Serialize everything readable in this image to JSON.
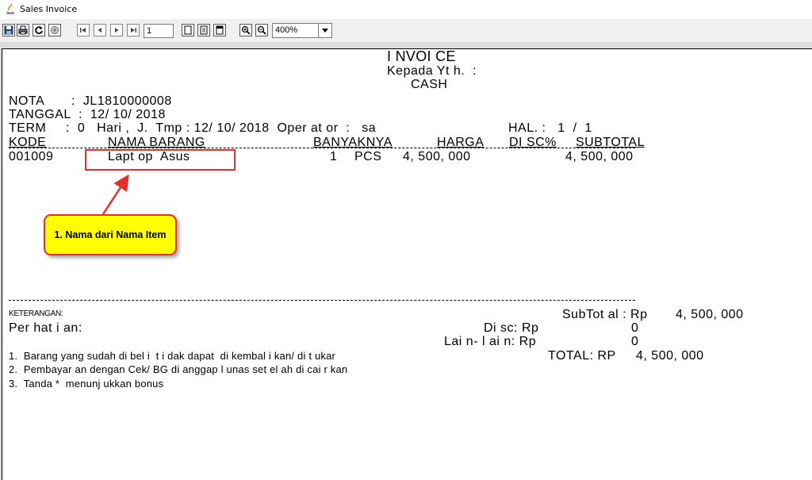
{
  "window": {
    "title": "Sales Invoice"
  },
  "toolbar": {
    "page_number": "1",
    "zoom": "400%",
    "buttons": [
      "save-icon",
      "print-icon",
      "refresh-icon",
      "export-icon",
      "first-page-icon",
      "prev-page-icon",
      "next-page-icon",
      "last-page-icon",
      "single-page-icon",
      "facing-page-icon",
      "fit-width-icon",
      "zoom-in-icon",
      "zoom-out-icon"
    ]
  },
  "invoice": {
    "title": "I NVOI CE",
    "kepada": "Kepada Yt h.  :",
    "customer": "CASH",
    "nota": "NOTA       :  JL1810000008",
    "tanggal": "TANGGAL  :  12/ 10/ 2018",
    "term_line": "TERM     :  0   Hari ,  J.  Tmp : 12/ 10/ 2018  Oper at or  :   sa",
    "hal": "HAL. :   1  /  1",
    "columns": {
      "kode": "KODE",
      "nama": "NAMA BARANG",
      "banyaknya": "BANYAKNYA",
      "harga": "HARGA",
      "disc": "DI SC%",
      "subtotal": "SUBTOTAL"
    },
    "items": [
      {
        "kode": "001009",
        "nama": "Lapt op  Asus",
        "qty": "1",
        "unit": "PCS",
        "harga": "4, 500, 000",
        "subtotal": "4, 500, 000"
      }
    ],
    "keterangan_label": "KETERANGAN:",
    "perhatian_label": "Per hat i an:",
    "notes": [
      "1.  Barang yang sudah di bel i  t i dak dapat  di kembal i kan/ di t ukar",
      "2.  Pembayar an dengan Cek/ BG di anggap l unas set el ah di cai r kan",
      "3.  Tanda *  menunj ukkan bonus"
    ],
    "totals": {
      "subtotal_label": "SubTot al : Rp",
      "subtotal_value": "4, 500, 000",
      "disc_label": "Di sc: Rp",
      "disc_value": "0",
      "lain_label": "Lai n- l ai n: Rp",
      "lain_value": "0",
      "total_label": "TOTAL: RP",
      "total_value": "4, 500, 000"
    }
  },
  "annotation": {
    "callout_text": "1. Nama dari Nama Item",
    "color": "#e0312f",
    "fill": "#ffff00"
  }
}
